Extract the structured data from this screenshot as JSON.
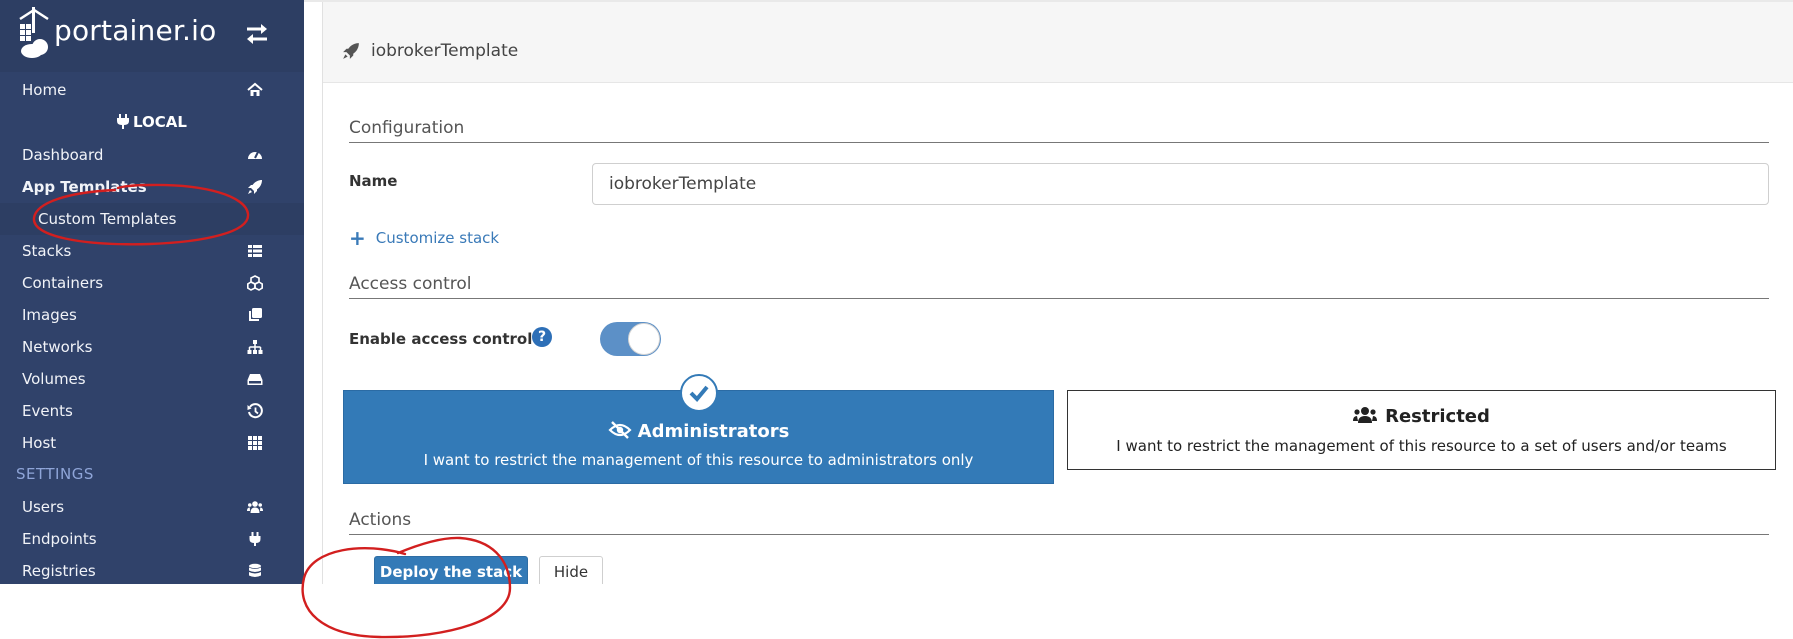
{
  "app": {
    "logo_text": "portainer.io"
  },
  "sidebar": {
    "home": "Home",
    "endpoint": "LOCAL",
    "dashboard": "Dashboard",
    "app_templates": "App Templates",
    "custom_templates": "Custom Templates",
    "stacks": "Stacks",
    "containers": "Containers",
    "images": "Images",
    "networks": "Networks",
    "volumes": "Volumes",
    "events": "Events",
    "host": "Host",
    "settings_heading": "SETTINGS",
    "users": "Users",
    "endpoints": "Endpoints",
    "registries": "Registries"
  },
  "panel": {
    "title": "iobrokerTemplate",
    "configuration_heading": "Configuration",
    "name_label": "Name",
    "name_value": "iobrokerTemplate",
    "customize_link": "Customize stack",
    "access_control_heading": "Access control",
    "enable_access_label": "Enable access control",
    "help_glyph": "?",
    "access_enabled": true,
    "admin_option": {
      "title": "Administrators",
      "description": "I want to restrict the management of this resource to administrators only",
      "selected": true
    },
    "restricted_option": {
      "title": "Restricted",
      "description": "I want to restrict the management of this resource to a set of users and/or teams",
      "selected": false
    },
    "actions_heading": "Actions",
    "deploy_button": "Deploy the stack",
    "hide_button": "Hide"
  },
  "colors": {
    "sidebar_bg": "#30426a",
    "primary": "#337ab7",
    "annotation": "#d21f1f"
  },
  "icons": {
    "logo": "portainer-logo-icon",
    "swap": "exchange-icon",
    "home": "home-icon",
    "endpoint": "plug-icon",
    "dashboard": "tachometer-icon",
    "app_templates": "rocket-icon",
    "stacks": "th-list-icon",
    "containers": "cubes-icon",
    "images": "clone-icon",
    "networks": "sitemap-icon",
    "volumes": "hdd-icon",
    "events": "history-icon",
    "host": "th-icon",
    "users": "users-icon",
    "endpoints": "plug-icon",
    "registries": "database-icon"
  }
}
